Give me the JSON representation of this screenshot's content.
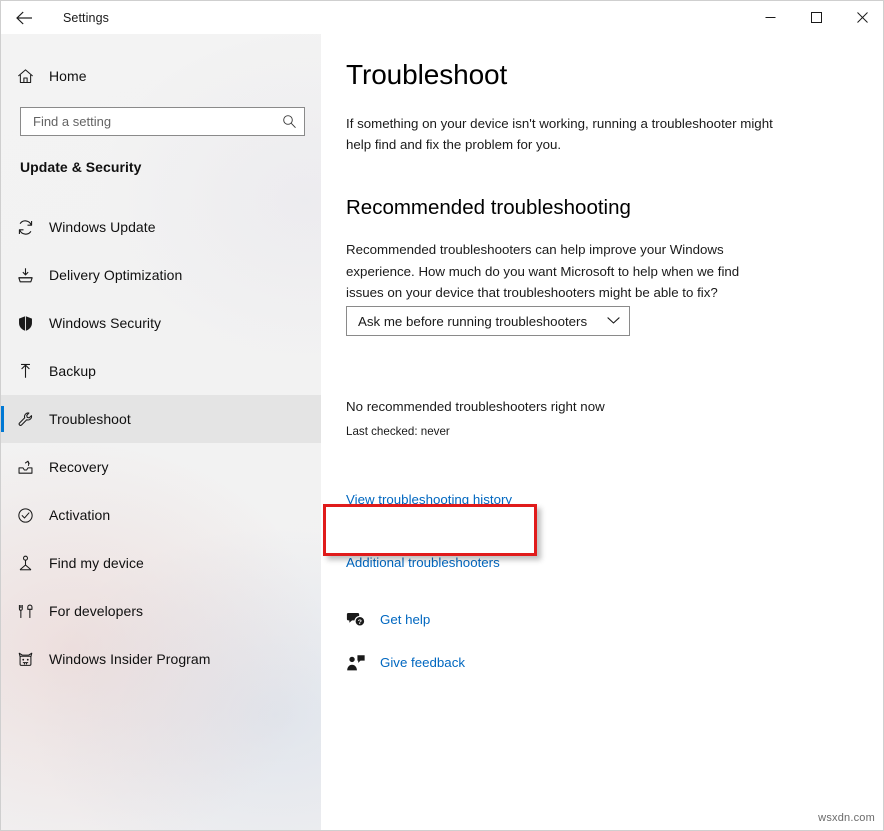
{
  "window": {
    "app_title": "Settings",
    "back_icon": "back-arrow-icon",
    "minimize_label": "Minimize",
    "maximize_label": "Maximize",
    "close_label": "Close"
  },
  "sidebar": {
    "home": {
      "label": "Home",
      "icon": "home-icon"
    },
    "search": {
      "value": "",
      "placeholder": "Find a setting",
      "icon": "search-icon"
    },
    "category": "Update & Security",
    "accent_color": "#0078d4",
    "items": [
      {
        "label": "Windows Update",
        "icon": "refresh-icon",
        "selected": false
      },
      {
        "label": "Delivery Optimization",
        "icon": "delivery-icon",
        "selected": false
      },
      {
        "label": "Windows Security",
        "icon": "shield-icon",
        "selected": false
      },
      {
        "label": "Backup",
        "icon": "upload-arrow-icon",
        "selected": false
      },
      {
        "label": "Troubleshoot",
        "icon": "wrench-icon",
        "selected": true
      },
      {
        "label": "Recovery",
        "icon": "recovery-icon",
        "selected": false
      },
      {
        "label": "Activation",
        "icon": "check-circle-icon",
        "selected": false
      },
      {
        "label": "Find my device",
        "icon": "find-device-icon",
        "selected": false
      },
      {
        "label": "For developers",
        "icon": "tools-icon",
        "selected": false
      },
      {
        "label": "Windows Insider Program",
        "icon": "insider-cat-icon",
        "selected": false
      }
    ]
  },
  "main": {
    "page_title": "Troubleshoot",
    "page_description": "If something on your device isn't working, running a troubleshooter might help find and fix the problem for you.",
    "section_title": "Recommended troubleshooting",
    "section_description": "Recommended troubleshooters can help improve your Windows experience. How much do you want Microsoft to help when we find issues on your device that troubleshooters might be able to fix?",
    "recommend_select": {
      "value": "Ask me before running troubleshooters",
      "icon": "chevron-down-icon"
    },
    "status_primary": "No recommended troubleshooters right now",
    "status_secondary": "Last checked: never",
    "history_link": "View troubleshooting history",
    "additional_link": "Additional troubleshooters",
    "link_color": "#0067c0",
    "support": [
      {
        "label": "Get help",
        "icon": "help-bubble-icon"
      },
      {
        "label": "Give feedback",
        "icon": "feedback-person-icon"
      }
    ]
  },
  "annotation": {
    "target": "Additional troubleshooters",
    "color": "#e01b1b"
  },
  "watermark": "wsxdn.com"
}
